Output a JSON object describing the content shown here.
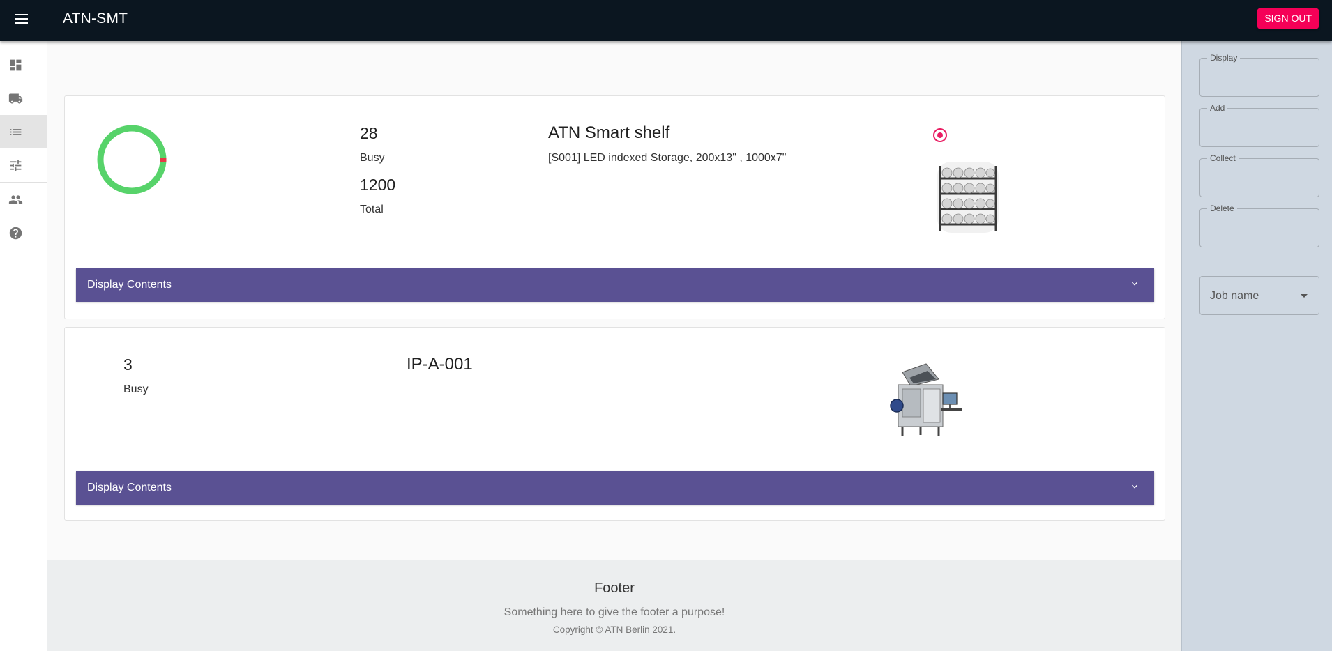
{
  "app": {
    "title": "ATN-SMT",
    "signout_label": "SIGN OUT"
  },
  "nav": {
    "items": [
      {
        "icon": "dashboard-icon"
      },
      {
        "icon": "truck-icon"
      },
      {
        "icon": "list-icon",
        "active": true
      },
      {
        "icon": "tune-icon"
      },
      {
        "icon": "people-icon"
      },
      {
        "icon": "help-icon"
      }
    ]
  },
  "cards": [
    {
      "busy": "28",
      "busy_label": "Busy",
      "total": "1200",
      "total_label": "Total",
      "title": "ATN Smart shelf",
      "description": "[S001] LED indexed Storage, 200x13\" , 1000x7\"",
      "gauge": {
        "used_fraction": 0.023,
        "free_color": "#57d36a",
        "used_color": "#e53945"
      },
      "image": "smart-shelf-image",
      "accordion_label": "Display Contents"
    },
    {
      "busy": "3",
      "busy_label": "Busy",
      "title": "IP-A-001",
      "image": "pick-and-place-machine-image",
      "accordion_label": "Display Contents"
    }
  ],
  "panel": {
    "fields": [
      {
        "label": "Display"
      },
      {
        "label": "Add"
      },
      {
        "label": "Collect"
      },
      {
        "label": "Delete"
      }
    ],
    "job_select": {
      "placeholder": "Job name"
    }
  },
  "footer": {
    "title": "Footer",
    "text": "Something here to give the footer a purpose!",
    "copyright": "Copyright © ATN Berlin 2021."
  },
  "colors": {
    "appbar": "#0b1620",
    "accent": "#f50057",
    "accordion": "#5a5193",
    "panel": "#cfd8e2"
  }
}
